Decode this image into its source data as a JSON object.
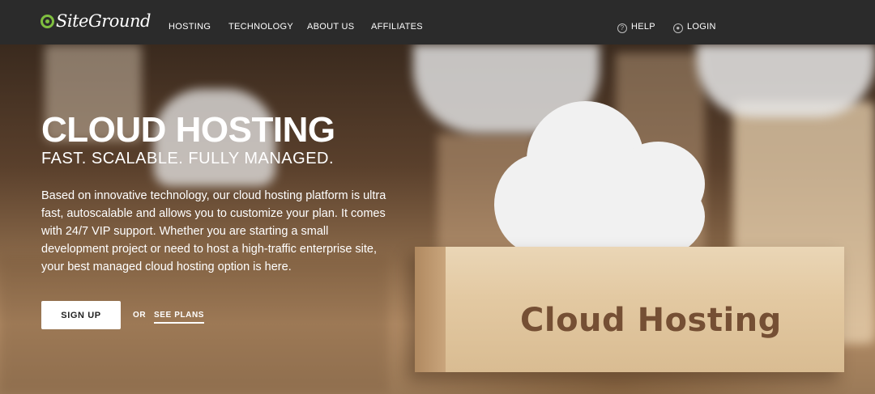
{
  "brand": {
    "name": "SiteGround",
    "accent": "#7fbf3f"
  },
  "nav": {
    "items": [
      {
        "label": "HOSTING"
      },
      {
        "label": "TECHNOLOGY"
      },
      {
        "label": "ABOUT US"
      },
      {
        "label": "AFFILIATES"
      }
    ],
    "help": {
      "label": "HELP",
      "icon": "help-icon"
    },
    "login": {
      "label": "LOGIN",
      "icon": "user-icon"
    }
  },
  "hero": {
    "title": "CLOUD HOSTING",
    "subtitle": "FAST. SCALABLE. FULLY MANAGED.",
    "description": "Based on innovative technology, our cloud hosting platform is ultra fast, autoscalable and allows you to customize your plan. It comes with 24/7 VIP support. Whether you are starting a small development project or need to host a high-traffic enterprise site, your best managed cloud hosting option is here.",
    "cta": "SIGN UP",
    "or": "OR",
    "plans_link": "SEE PLANS",
    "block_text": "Cloud Hosting"
  },
  "colors": {
    "navbar": "#2b2b2b",
    "button": "#ffffff"
  }
}
